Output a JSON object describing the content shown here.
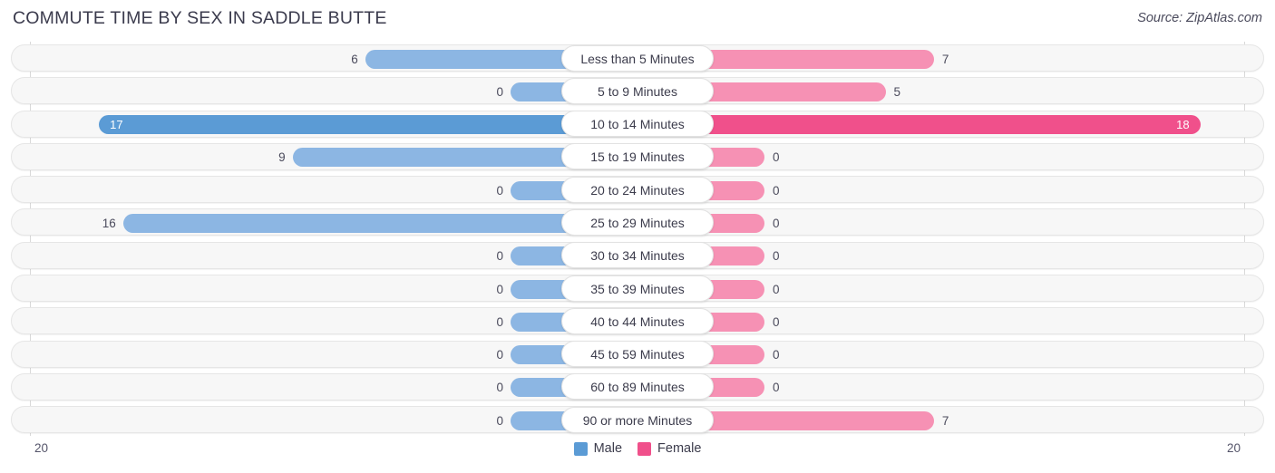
{
  "header": {
    "title": "COMMUTE TIME BY SEX IN SADDLE BUTTE",
    "source": "Source: ZipAtlas.com"
  },
  "legend": {
    "male_label": "Male",
    "female_label": "Female",
    "male_color": "#5b9bd5",
    "female_color": "#f0508b"
  },
  "axis": {
    "left_tick": "20",
    "right_tick": "20"
  },
  "chart_data": {
    "type": "bar",
    "orientation": "horizontal-diverging",
    "title": "COMMUTE TIME BY SEX IN SADDLE BUTTE",
    "xlabel": "",
    "ylabel": "",
    "xlim": [
      20,
      20
    ],
    "grid": false,
    "legend_position": "bottom-center",
    "categories": [
      "Less than 5 Minutes",
      "5 to 9 Minutes",
      "10 to 14 Minutes",
      "15 to 19 Minutes",
      "20 to 24 Minutes",
      "25 to 29 Minutes",
      "30 to 34 Minutes",
      "35 to 39 Minutes",
      "40 to 44 Minutes",
      "45 to 59 Minutes",
      "60 to 89 Minutes",
      "90 or more Minutes"
    ],
    "series": [
      {
        "name": "Male",
        "values": [
          6,
          0,
          17,
          9,
          0,
          16,
          0,
          0,
          0,
          0,
          0,
          0
        ]
      },
      {
        "name": "Female",
        "values": [
          7,
          5,
          18,
          0,
          0,
          0,
          0,
          0,
          0,
          0,
          0,
          7
        ]
      }
    ]
  },
  "rows": [
    {
      "label": "Less than 5 Minutes",
      "male": "6",
      "female": "7"
    },
    {
      "label": "5 to 9 Minutes",
      "male": "0",
      "female": "5"
    },
    {
      "label": "10 to 14 Minutes",
      "male": "17",
      "female": "18"
    },
    {
      "label": "15 to 19 Minutes",
      "male": "9",
      "female": "0"
    },
    {
      "label": "20 to 24 Minutes",
      "male": "0",
      "female": "0"
    },
    {
      "label": "25 to 29 Minutes",
      "male": "16",
      "female": "0"
    },
    {
      "label": "30 to 34 Minutes",
      "male": "0",
      "female": "0"
    },
    {
      "label": "35 to 39 Minutes",
      "male": "0",
      "female": "0"
    },
    {
      "label": "40 to 44 Minutes",
      "male": "0",
      "female": "0"
    },
    {
      "label": "45 to 59 Minutes",
      "male": "0",
      "female": "0"
    },
    {
      "label": "60 to 89 Minutes",
      "male": "0",
      "female": "0"
    },
    {
      "label": "90 or more Minutes",
      "male": "0",
      "female": "7"
    }
  ]
}
